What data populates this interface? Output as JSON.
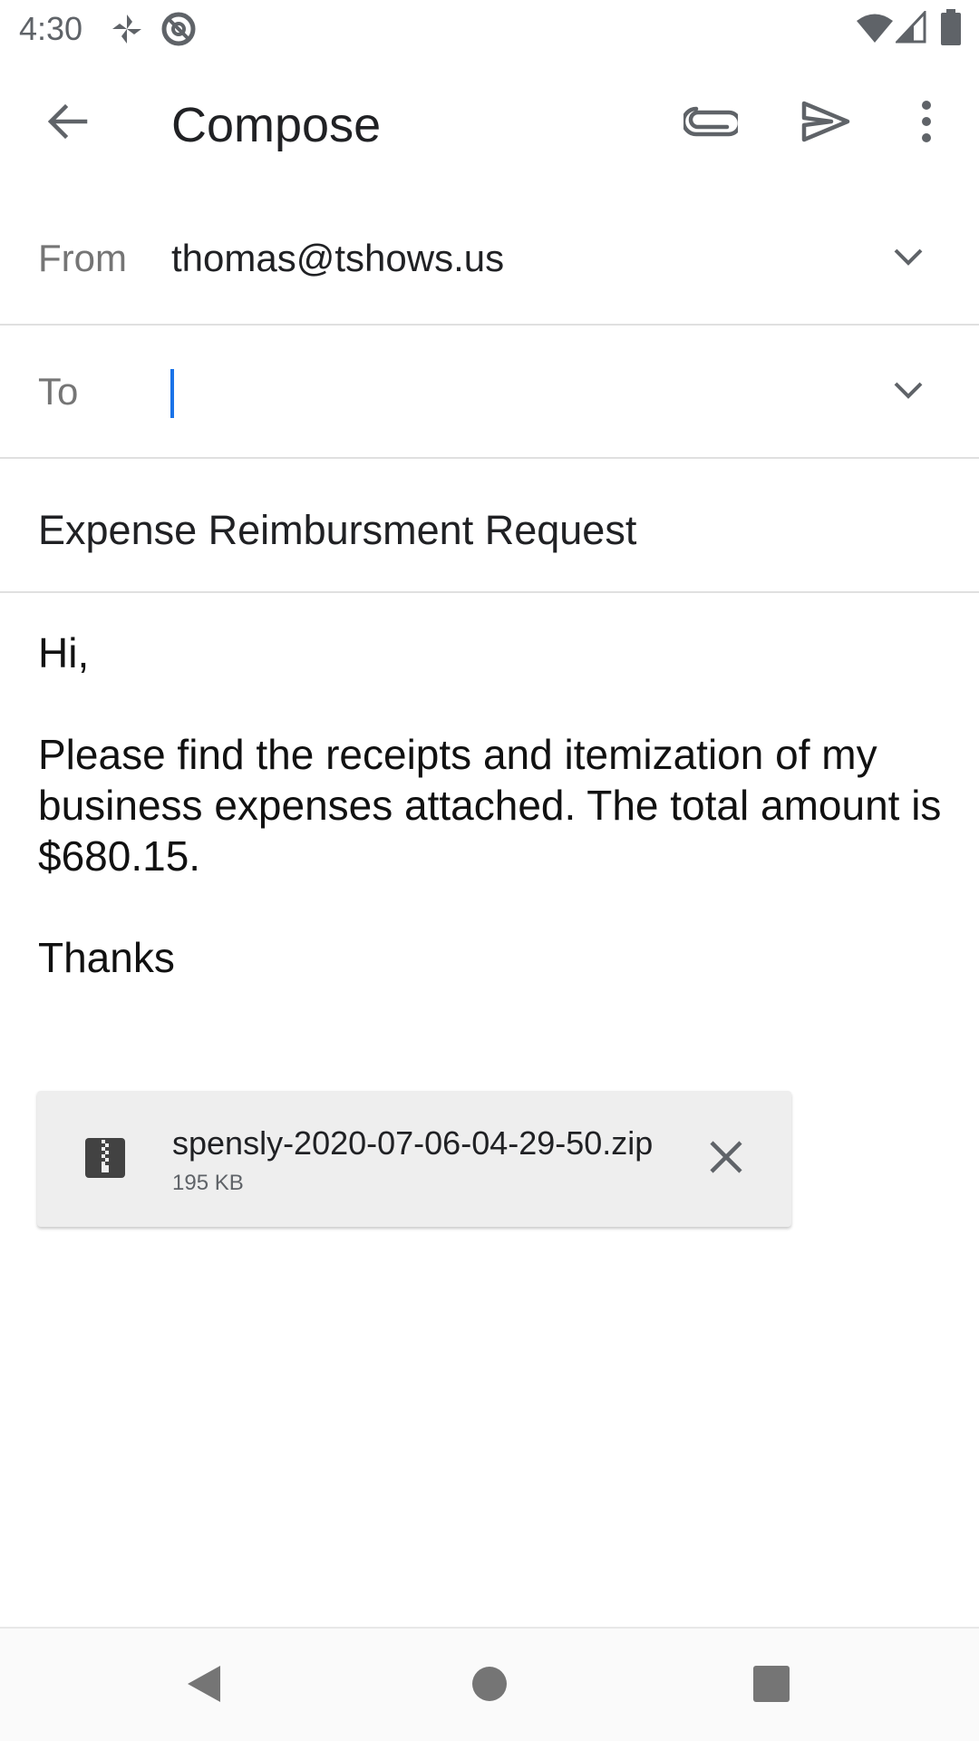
{
  "status_bar": {
    "time": "4:30",
    "left_icons": [
      "pinwheel-icon",
      "at-sign-icon"
    ],
    "right_icons": [
      "wifi-icon",
      "cell-signal-icon",
      "battery-icon"
    ]
  },
  "app_bar": {
    "title": "Compose",
    "icons": [
      "back-arrow-icon",
      "attach-icon",
      "send-icon",
      "more-vert-icon"
    ]
  },
  "from_field": {
    "label": "From",
    "value": "thomas@tshows.us"
  },
  "to_field": {
    "label": "To",
    "value": ""
  },
  "subject": "Expense Reimbursment Request",
  "body": {
    "greeting": "Hi,",
    "line1": "Please find the receipts and itemization of my business expenses attached.  The total amount is $680.15.",
    "closing": "Thanks"
  },
  "attachment": {
    "file_name": "spensly-2020-07-06-04-29-50.zip",
    "file_size": "195 KB",
    "icon": "zip-file-icon"
  },
  "nav_bar": {
    "icons": [
      "nav-back-icon",
      "nav-home-icon",
      "nav-recents-icon"
    ]
  },
  "colors": {
    "accent": "#1a73e8",
    "icon_gray": "#5f6368",
    "label_gray": "#757575"
  }
}
